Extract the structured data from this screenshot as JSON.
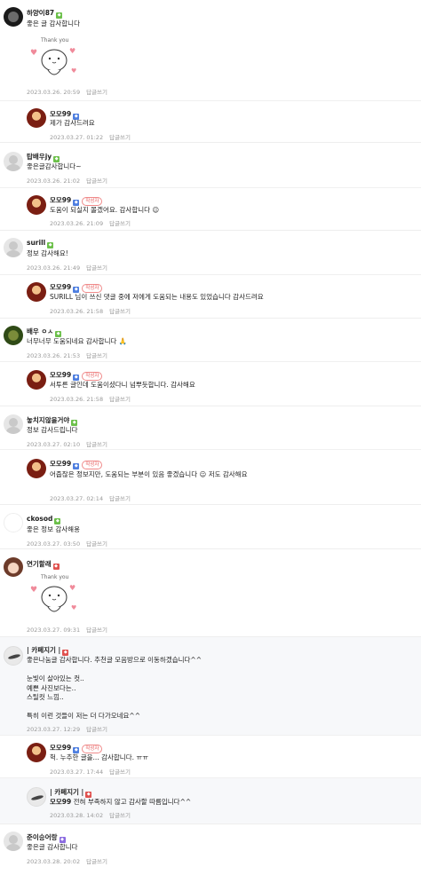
{
  "reply_label": "답글쓰기",
  "writer_label": "작성자",
  "sticker": {
    "text": "Thank you"
  },
  "comments": [
    {
      "name": "하양이87",
      "badge": "g",
      "text": "좋은 글 감사합니다",
      "time": "2023.03.26. 20:59"
    },
    {
      "name": "모모99",
      "badge": "b",
      "writer": true,
      "text": "제가 감사드려요",
      "time": "2023.03.27. 01:22"
    },
    {
      "name": "탑배우jy",
      "badge": "g",
      "text": "좋은글감사합니다~",
      "time": "2023.03.26. 21:02"
    },
    {
      "name": "모모99",
      "badge": "b",
      "writer": true,
      "text": "도움이 되실지 몰겠어요. 감사합니다 ☺",
      "time": "2023.03.26. 21:09"
    },
    {
      "name": "surill",
      "badge": "g",
      "text": "정보 감사해요!",
      "time": "2023.03.26. 21:49"
    },
    {
      "name": "모모99",
      "badge": "b",
      "writer": true,
      "text": "SURILL 님이 쓰신 댓글 중에 저에게 도움되는 내용도 있었습니다 감사드려요",
      "time": "2023.03.26. 21:58"
    },
    {
      "name": "배우 ㅇㅅ",
      "badge": "g",
      "text": "너무너무 도움되네요 감사합니다 🙏",
      "time": "2023.03.26. 21:53"
    },
    {
      "name": "모모99",
      "badge": "b",
      "writer": true,
      "text": "서투른 글인데 도움이셨다니 넘뿌듯합니다. 감사해요",
      "time": "2023.03.26. 21:58"
    },
    {
      "name": "놓치지않을거야",
      "badge": "g",
      "text": "정보 감사드립니다",
      "time": "2023.03.27. 02:10"
    },
    {
      "name": "모모99",
      "badge": "b",
      "writer": true,
      "text": "어줍잖은 정보지만, 도움되는 부분이 있음 좋겠습니다 ☺ 저도 감사해요",
      "time": "2023.03.27. 02:14"
    },
    {
      "name": "ckosod",
      "badge": "g",
      "text": "좋은 정보 감사해용",
      "time": "2023.03.27. 03:50"
    },
    {
      "name": "연기할래",
      "badge": "r",
      "text": "",
      "time": "2023.03.27. 09:31"
    },
    {
      "name": "| 카페지기 |",
      "badge": "r",
      "text": "좋은나눔글 감사합니다. 추천글 모음방으로 이동하겠습니다^^\n\n눈빛이 살아있는 컷..\n예쁜 사진보다는..\n스틸컷 느낌..\n\n특히 이런 것들이 저는 더 다가오네요^^",
      "time": "2023.03.27. 12:29"
    },
    {
      "name": "모모99",
      "badge": "b",
      "writer": true,
      "text": "헉. 누추한 글을... 감사합니다. ㅠㅠ",
      "time": "2023.03.27. 17:44"
    },
    {
      "name": "| 카페지기 |",
      "badge": "r",
      "mention": "모모99",
      "text": "전혀 부족하지 않고 감사할 따름입니다^^",
      "time": "2023.03.28. 14:02"
    },
    {
      "name": "준이승어랑",
      "badge": "p",
      "text": "좋은글 감사합니다",
      "time": "2023.03.28. 20:02"
    }
  ]
}
